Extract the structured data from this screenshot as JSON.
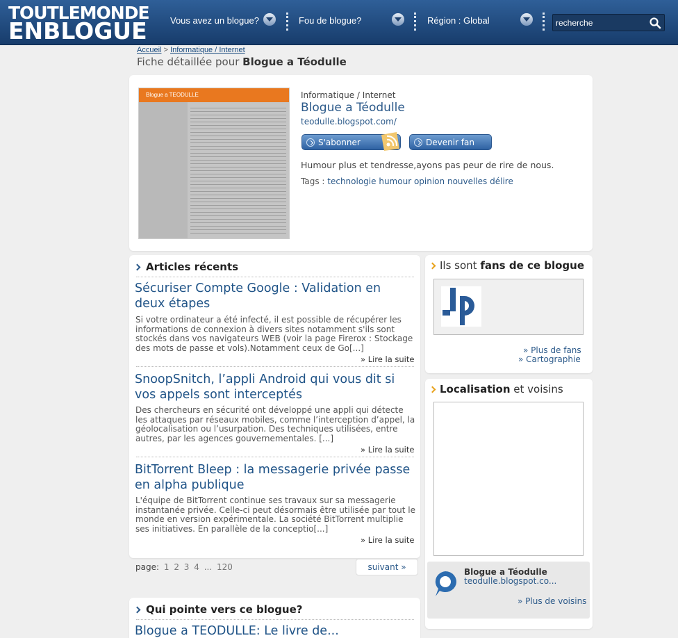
{
  "header": {
    "logo_line1": "TOUTLEMONDE",
    "logo_line2": "ENBLOGUE",
    "nav": [
      "Vous avez un blogue?",
      "Fou de blogue?",
      "Région : Global"
    ],
    "search_placeholder": "recherche"
  },
  "breadcrumb": {
    "home": "Accueil",
    "separator": ">",
    "category": "Informatique / Internet"
  },
  "page_title": {
    "prefix": "Fiche détaillée pour",
    "blog": "Blogue a Téodulle"
  },
  "blog": {
    "thumb_title": "Blogue a TEODULLE",
    "category": "Informatique / Internet",
    "name": "Blogue a Téodulle",
    "url": "teodulle.blogspot.com/",
    "subscribe_label": "S'abonner",
    "fan_label": "Devenir fan",
    "description": "Humour plus et tendresse,ayons pas peur de rire de nous.",
    "tags_label": "Tags :",
    "tags": [
      "technologie",
      "humour",
      "opinion",
      "nouvelles",
      "délire"
    ]
  },
  "recent": {
    "title": "Articles récents",
    "more_label": "» Lire la suite",
    "articles": [
      {
        "title": "Sécuriser Compte Google : Validation en deux étapes",
        "text": "Si votre ordinateur a été infecté, il est possible de récupérer les informations de connexion à divers sites notamment s'ils sont stockés dans vos navigateurs WEB (voir la page Firerox : Stockage des mots de passe et vols).Notamment ceux de Go[...]"
      },
      {
        "title": "SnoopSnitch, l’appli Android qui vous dit si vos appels sont interceptés",
        "text": "Des chercheurs en sécurité ont développé une appli qui détecte les attaques par réseaux mobiles, comme l’interception d’appel, la géolocalisation ou l’usurpation. Des techniques utilisées, entre autres, par les agences gouvernementales. [...]"
      },
      {
        "title": "BitTorrent Bleep : la messagerie privée passe en alpha publique",
        "text": "L'équipe de BitTorrent continue ses travaux sur sa messagerie instantanée privée. Celle-ci peut désormais être utilisée par tout le monde en version expérimentale. La société BitTorrent multiplie ses initiatives. En parallèle de la conceptio[...]"
      }
    ]
  },
  "pager": {
    "label": "page:",
    "pages": [
      "1",
      "2",
      "3",
      "4",
      "...",
      "120"
    ],
    "next": "suivant »"
  },
  "backlinks": {
    "title": "Qui pointe vers ce blogue?",
    "first_item": "Blogue a TEODULLE: Le livre de..."
  },
  "fans": {
    "prefix": "Ils sont",
    "bold": "fans de ce blogue",
    "more": "» Plus de fans",
    "map": "» Cartographie"
  },
  "location": {
    "bold": "Localisation",
    "suffix": "et voisins",
    "neighbor_name": "Blogue a Téodulle",
    "neighbor_url": "teodulle.blogspot.co...",
    "more": "» Plus de voisins"
  },
  "colors": {
    "header": "#2f5f98",
    "link": "#1f5387",
    "accent": "#e8a21b"
  }
}
